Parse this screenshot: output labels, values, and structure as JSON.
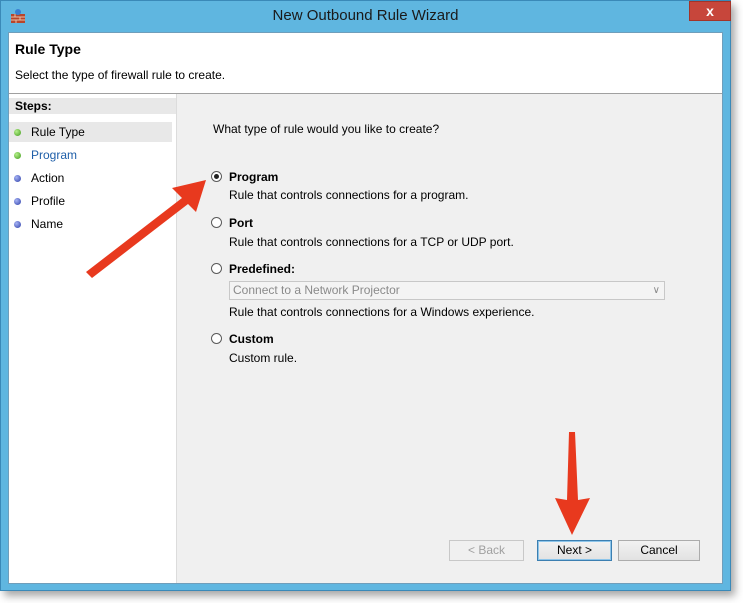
{
  "window": {
    "title": "New Outbound Rule Wizard",
    "close_glyph": "x"
  },
  "header": {
    "title": "Rule Type",
    "subtitle": "Select the type of firewall rule to create."
  },
  "steps": {
    "heading": "Steps:",
    "items": [
      {
        "label": "Rule Type",
        "status": "current",
        "dot_color": "#3f9a1b"
      },
      {
        "label": "Program",
        "status": "completed",
        "dot_color": "#3f9a1b"
      },
      {
        "label": "Action",
        "status": "pending",
        "dot_color": "#2c3ea8"
      },
      {
        "label": "Profile",
        "status": "pending",
        "dot_color": "#2c3ea8"
      },
      {
        "label": "Name",
        "status": "pending",
        "dot_color": "#2c3ea8"
      }
    ]
  },
  "main": {
    "question": "What type of rule would you like to create?",
    "options": [
      {
        "label": "Program",
        "description": "Rule that controls connections for a program.",
        "selected": true
      },
      {
        "label": "Port",
        "description": "Rule that controls connections for a TCP or UDP port.",
        "selected": false
      },
      {
        "label": "Predefined:",
        "description": "Rule that controls connections for a Windows experience.",
        "selected": false
      },
      {
        "label": "Custom",
        "description": "Custom rule.",
        "selected": false
      }
    ],
    "predefined_select": {
      "value": "Connect to a Network Projector",
      "enabled": false
    }
  },
  "buttons": {
    "back": "< Back",
    "next": "Next >",
    "cancel": "Cancel"
  },
  "annotations": {
    "arrow_color": "#e8391e"
  }
}
